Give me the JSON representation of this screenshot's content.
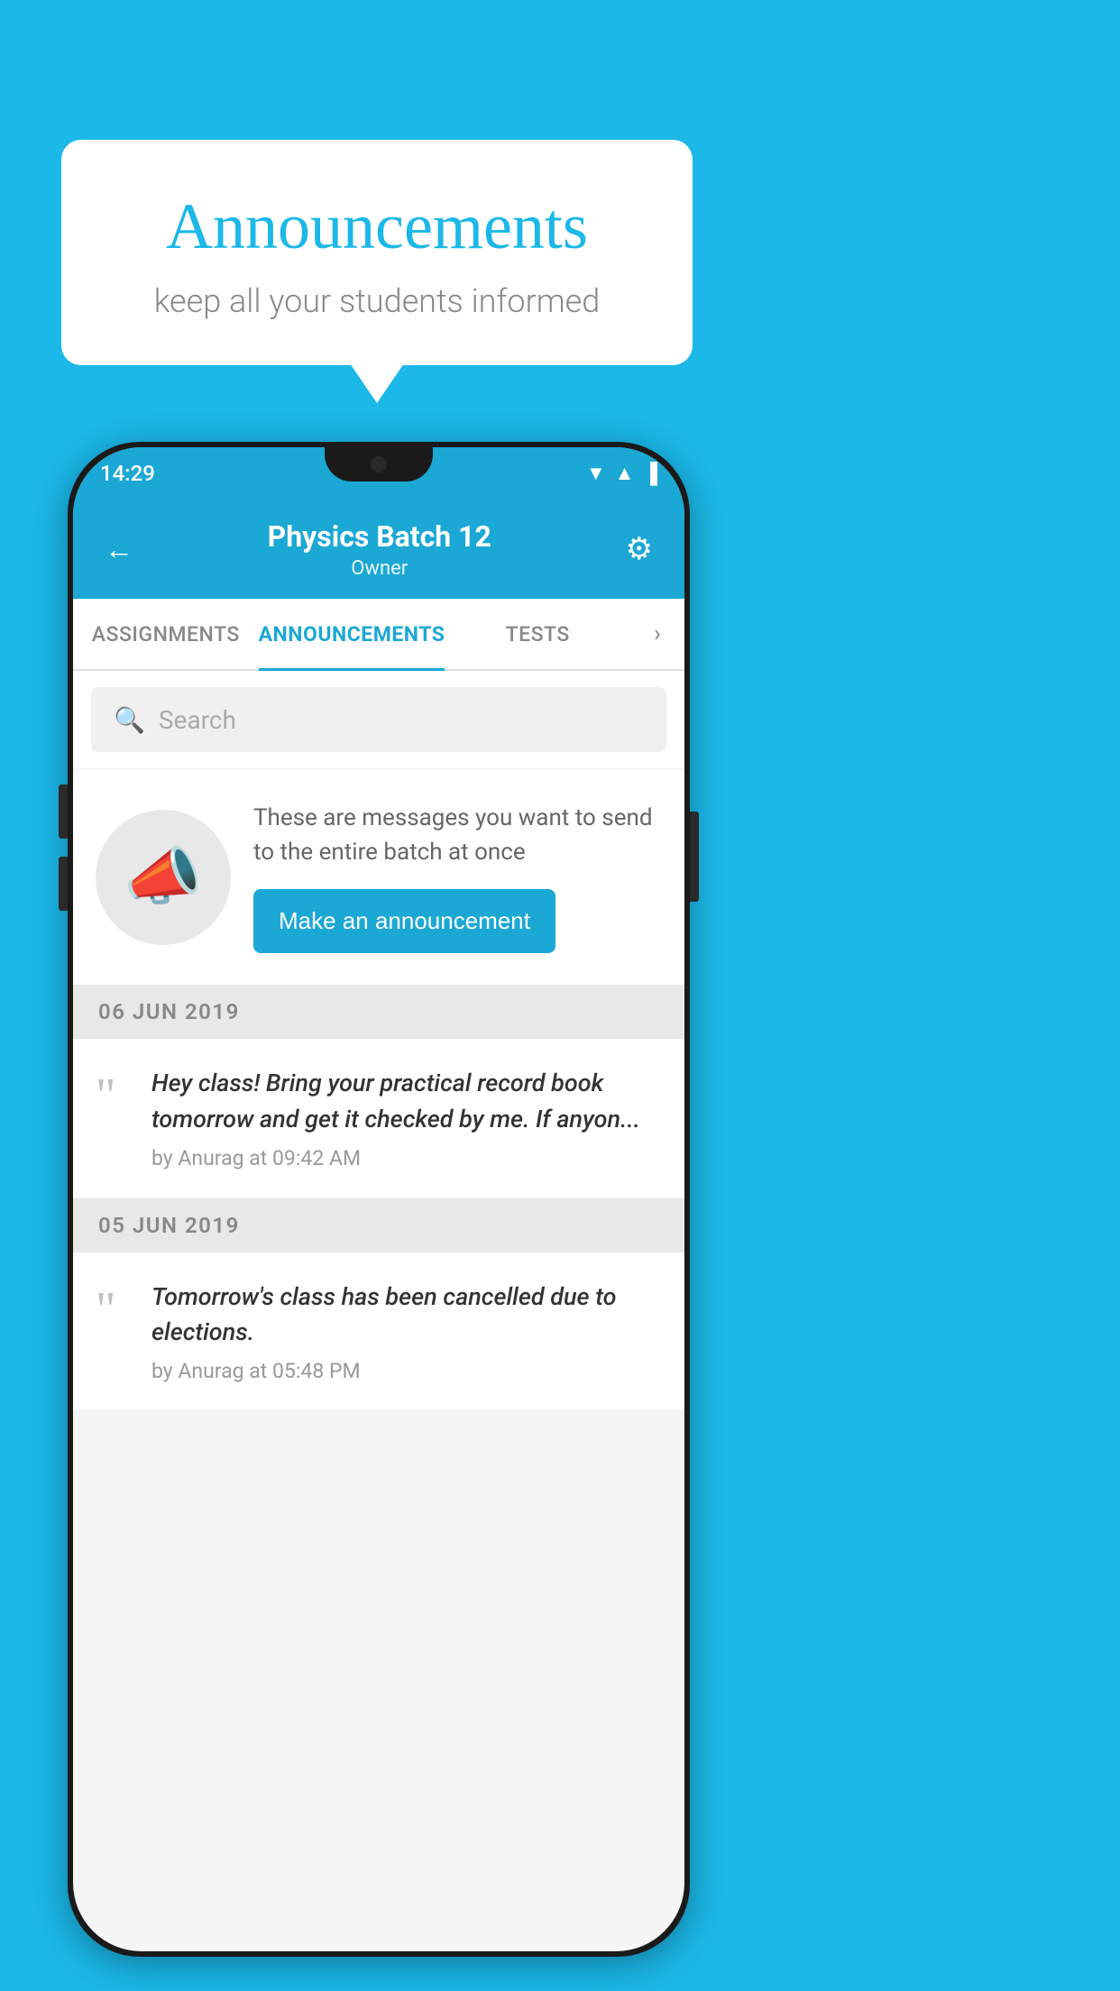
{
  "background_color": "#1BB8E8",
  "speech_bubble": {
    "title": "Announcements",
    "subtitle": "keep all your students informed"
  },
  "phone": {
    "status_bar": {
      "time": "14:29",
      "icons": [
        "wifi",
        "signal",
        "battery"
      ]
    },
    "app_bar": {
      "title": "Physics Batch 12",
      "subtitle": "Owner",
      "back_label": "←",
      "settings_label": "⚙"
    },
    "tabs": [
      {
        "label": "ASSIGNMENTS",
        "active": false
      },
      {
        "label": "ANNOUNCEMENTS",
        "active": true
      },
      {
        "label": "TESTS",
        "active": false
      }
    ],
    "search": {
      "placeholder": "Search"
    },
    "announcement_prompt": {
      "description": "These are messages you want to send to the entire batch at once",
      "button_label": "Make an announcement"
    },
    "announcements": [
      {
        "date": "06  JUN  2019",
        "text": "Hey class! Bring your practical record book tomorrow and get it checked by me. If anyon...",
        "meta": "by Anurag at 09:42 AM"
      },
      {
        "date": "05  JUN  2019",
        "text": "Tomorrow's class has been cancelled due to elections.",
        "meta": "by Anurag at 05:48 PM"
      }
    ]
  }
}
